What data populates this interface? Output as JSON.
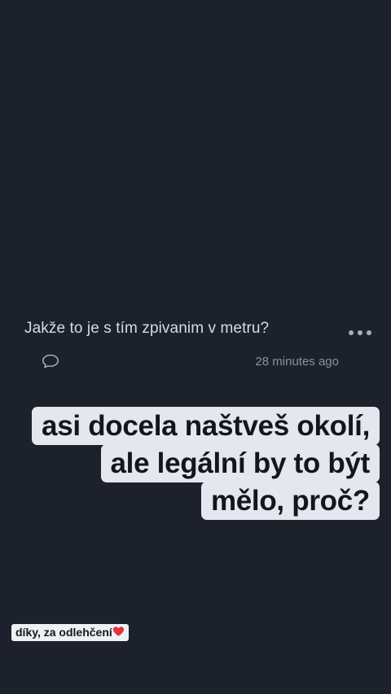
{
  "post": {
    "question": "Jakže to je s tím zpivanim v metru?",
    "time_ago": "28 minutes ago",
    "icons": {
      "more": "more-dots-icon",
      "comment": "comment-bubble-icon"
    }
  },
  "answer": {
    "lines": [
      "asi docela naštveš okolí,",
      "ale legální by to být",
      "mělo, proč?"
    ]
  },
  "sticker": {
    "text": "díky, za odlehčení",
    "emoji_icon": "red-heart-icon"
  },
  "colors": {
    "background": "#1c212c",
    "answer_bg": "#e4e7ee",
    "heart": "#e0313c"
  }
}
